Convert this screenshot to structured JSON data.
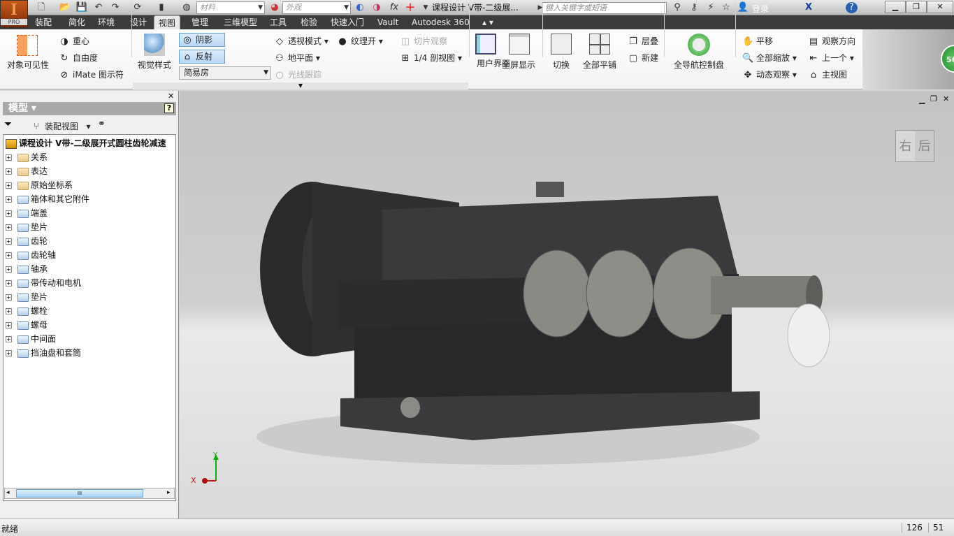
{
  "app": {
    "logo_text": "I",
    "edition": "PRO",
    "title": "课程设计 V带-二级展...",
    "search_placeholder": "键入关键字或短语",
    "login": "登录"
  },
  "qat": {
    "material_placeholder": "材料",
    "appearance_placeholder": "外观"
  },
  "tabs": [
    "装配",
    "简化",
    "环境",
    "设计",
    "视图",
    "管理",
    "三维模型",
    "工具",
    "检验",
    "快速入门",
    "Vault",
    "Autodesk 360"
  ],
  "active_tab": "视图",
  "ribbon": {
    "visibility": {
      "object_visibility": "对象可见性",
      "center_of_gravity": "重心",
      "dof": "自由度",
      "imate": "iMate 图示符"
    },
    "appearance": {
      "visual_style": "视觉样式",
      "shadows": "阴影",
      "reflections": "反射",
      "environment": "简易房",
      "perspective": "透视模式",
      "ground_plane": "地平面",
      "ray_tracing": "光线跟踪",
      "texture": "纹理开",
      "slice": "切片观察",
      "quarter_section": "1/4 剖视图"
    },
    "windows": {
      "user_interface": "用户界面",
      "fullscreen": "全屏显示",
      "switch": "切换",
      "tile_all": "全部平铺",
      "cascade": "层叠",
      "new": "新建"
    },
    "navigate": {
      "full_nav_wheel": "全导航控制盘",
      "pan": "平移",
      "zoom_all": "全部缩放",
      "orbit": "动态观察",
      "look_at": "观察方向",
      "previous": "上一个",
      "home": "主视图"
    },
    "badge": "56"
  },
  "browser": {
    "title": "模型",
    "view_selector": "装配视图",
    "root": "课程设计 V带-二级展开式圆柱齿轮减速",
    "items": [
      "关系",
      "表达",
      "原始坐标系",
      "箱体和其它附件",
      "端盖",
      "垫片",
      "齿轮",
      "齿轮轴",
      "轴承",
      "带传动和电机",
      "垫片",
      "螺栓",
      "螺母",
      "中间面",
      "挡油盘和套筒"
    ]
  },
  "viewcube": {
    "right": "右",
    "back": "后"
  },
  "triad": {
    "x": "X",
    "y": "Y"
  },
  "status": {
    "text": "就绪",
    "val1": "126",
    "val2": "51"
  }
}
